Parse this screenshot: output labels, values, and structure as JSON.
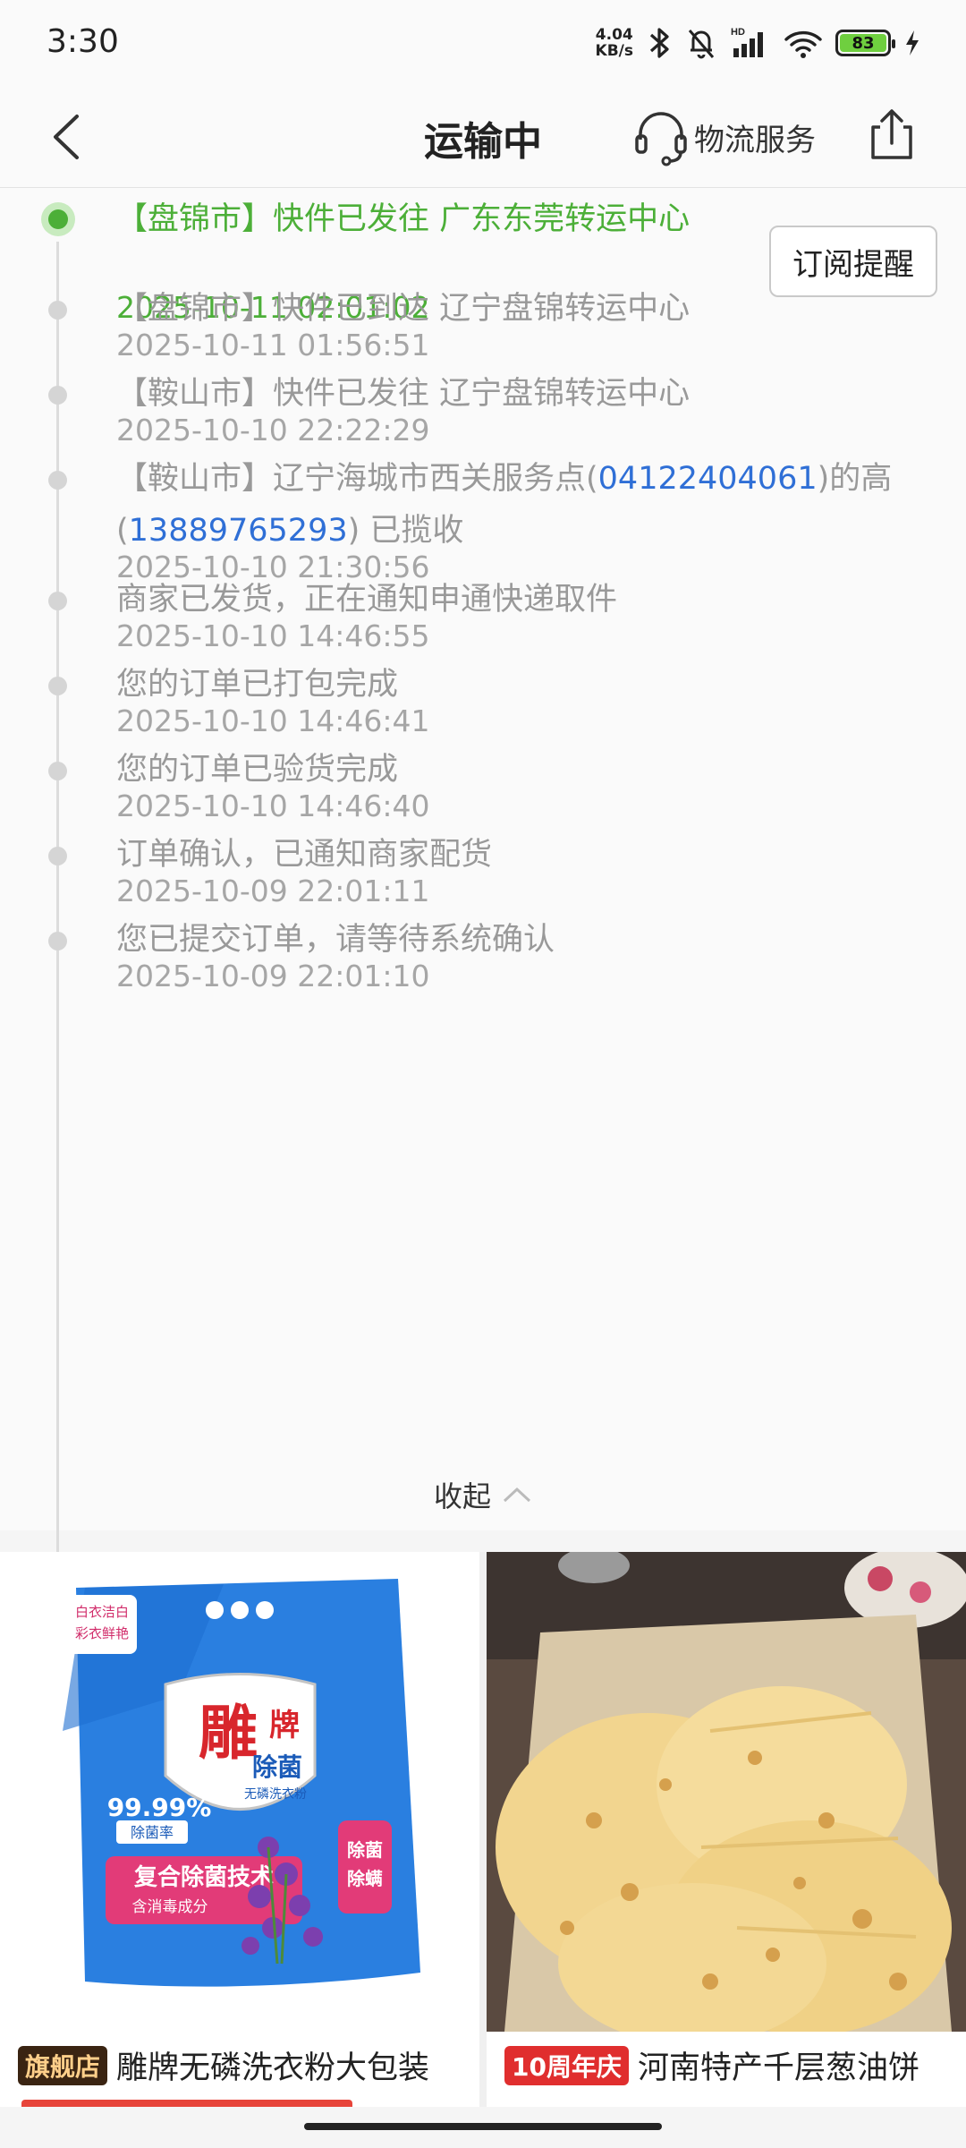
{
  "status_bar": {
    "time": "3:30",
    "net_speed_value": "4.04",
    "net_speed_unit": "KB/s",
    "hd_label": "HD",
    "battery_level": "83",
    "icons": [
      "bluetooth-icon",
      "mute-bell-icon",
      "signal-icon",
      "wifi-icon",
      "battery-icon",
      "charging-icon"
    ]
  },
  "header": {
    "title": "运输中",
    "service_label": "物流服务",
    "icons": [
      "back-arrow-icon",
      "headset-icon",
      "share-icon"
    ]
  },
  "subscribe_button": "订阅提醒",
  "timeline": [
    {
      "segments": [
        {
          "text": "【盘锦市】快件已发往 广东东莞转运中心"
        }
      ],
      "time": "2025-10-11 02:01:02",
      "active": true
    },
    {
      "segments": [
        {
          "text": "【盘锦市】快件已到达 辽宁盘锦转运中心"
        }
      ],
      "time": "2025-10-11 01:56:51",
      "active": false
    },
    {
      "segments": [
        {
          "text": "【鞍山市】快件已发往 辽宁盘锦转运中心"
        }
      ],
      "time": "2025-10-10 22:22:29",
      "active": false
    },
    {
      "segments": [
        {
          "text": "【鞍山市】辽宁海城市西关服务点("
        },
        {
          "text": "04122404061",
          "link": true
        },
        {
          "text": ")的高("
        },
        {
          "text": "13889765293",
          "link": true
        },
        {
          "text": ") 已揽收"
        }
      ],
      "time": "2025-10-10 21:30:56",
      "active": false
    },
    {
      "segments": [
        {
          "text": "商家已发货，正在通知申通快递取件"
        }
      ],
      "time": "2025-10-10 14:46:55",
      "active": false
    },
    {
      "segments": [
        {
          "text": "您的订单已打包完成"
        }
      ],
      "time": "2025-10-10 14:46:41",
      "active": false
    },
    {
      "segments": [
        {
          "text": "您的订单已验货完成"
        }
      ],
      "time": "2025-10-10 14:46:40",
      "active": false
    },
    {
      "segments": [
        {
          "text": "订单确认，已通知商家配货"
        }
      ],
      "time": "2025-10-09 22:01:11",
      "active": false
    },
    {
      "segments": [
        {
          "text": "您已提交订单，请等待系统确认"
        }
      ],
      "time": "2025-10-09 22:01:10",
      "active": false
    }
  ],
  "collapse_label": "收起",
  "products": [
    {
      "badge": "旗舰店",
      "name": "雕牌无磷洗衣粉大包装",
      "image_icon": "detergent-bag-image",
      "package_text": {
        "brand": "雕牌",
        "corner": "白衣洁白 彩衣鲜艳",
        "main": "除菌",
        "sub": "无磷洗衣粉",
        "rate": "99.99%",
        "rate_label": "除菌率",
        "tech": "复合除菌技术",
        "tech_sub": "含消毒成分",
        "side": "除菌除螨"
      }
    },
    {
      "badge": "10周年庆",
      "name": "河南特产千层葱油饼",
      "image_icon": "flatbread-image"
    }
  ],
  "colors": {
    "accent_green": "#4caf38",
    "link_blue": "#2f6fd6",
    "muted_text": "#999999"
  }
}
